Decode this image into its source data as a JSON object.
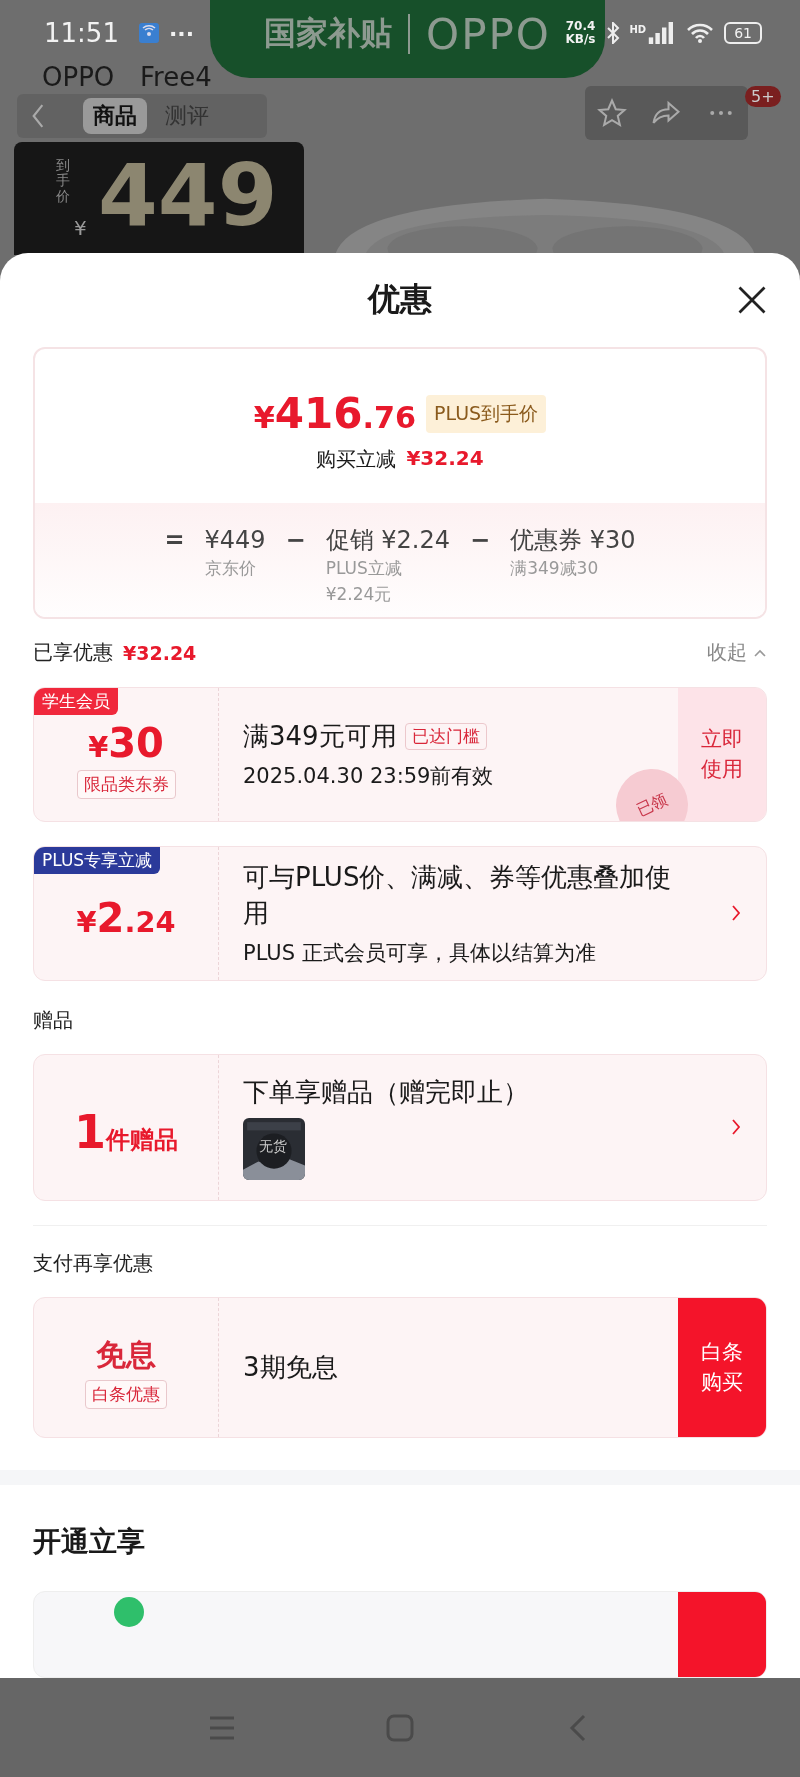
{
  "status_bar": {
    "time": "11:51",
    "more": "···",
    "speed_value": "70.4",
    "speed_unit": "KB/s",
    "network": "HD",
    "battery": "61"
  },
  "backdrop": {
    "banner_left": "国家补贴",
    "banner_right": "OPPO",
    "title_parts": [
      "OPPO",
      "Free4"
    ],
    "tabs": [
      {
        "label": "商品",
        "selected": true
      },
      {
        "label": "测评",
        "selected": false
      }
    ],
    "badge": "5+",
    "price_label": "到手价",
    "price_currency": "¥",
    "price": "449"
  },
  "sheet": {
    "title": "优惠",
    "summary": {
      "currency": "¥",
      "integer": "416",
      "decimal": ".76",
      "tag": "PLUS到手价",
      "saving_label": "购买立减",
      "saving": "¥32.24",
      "formula": [
        {
          "kind": "symbol",
          "text": "="
        },
        {
          "kind": "term",
          "value": "¥449",
          "note": "京东价"
        },
        {
          "kind": "symbol",
          "text": "−"
        },
        {
          "kind": "term",
          "value": "促销 ¥2.24",
          "note": "PLUS立减 ¥2.24元"
        },
        {
          "kind": "symbol",
          "text": "−"
        },
        {
          "kind": "term",
          "value": "优惠券 ¥30",
          "note": "满349减30"
        }
      ]
    },
    "enjoyed": {
      "label": "已享优惠",
      "amount": "¥32.24",
      "toggle": "收起",
      "expanded": true
    },
    "offers": [
      {
        "kind": "coupon",
        "tag": "学生会员",
        "color": "#f0283c",
        "currency": "¥",
        "amount": "30",
        "sub": "限品类东券",
        "title": "满349元可用",
        "badge": "已达门槛",
        "detail": "2025.04.30 23:59前有效",
        "action": "立即使用",
        "stamp": "已领"
      },
      {
        "kind": "discount",
        "tag": "PLUS专享立减",
        "color": "#2b3a9a",
        "currency": "¥",
        "amount": "2",
        "decimal": ".24",
        "title": "可与PLUS价、满减、券等优惠叠加使用",
        "detail": "PLUS 正式会员可享，具体以结算为准"
      }
    ],
    "gift": {
      "label": "赠品",
      "count": "1",
      "unit": "件赠品",
      "title": "下单享赠品（赠完即止）",
      "thumb_text": "无货"
    },
    "pay": {
      "label": "支付再享优惠",
      "big": "免息",
      "sub": "白条优惠",
      "title": "3期免息",
      "action": "白条购买"
    },
    "open": {
      "label": "开通立享"
    }
  }
}
